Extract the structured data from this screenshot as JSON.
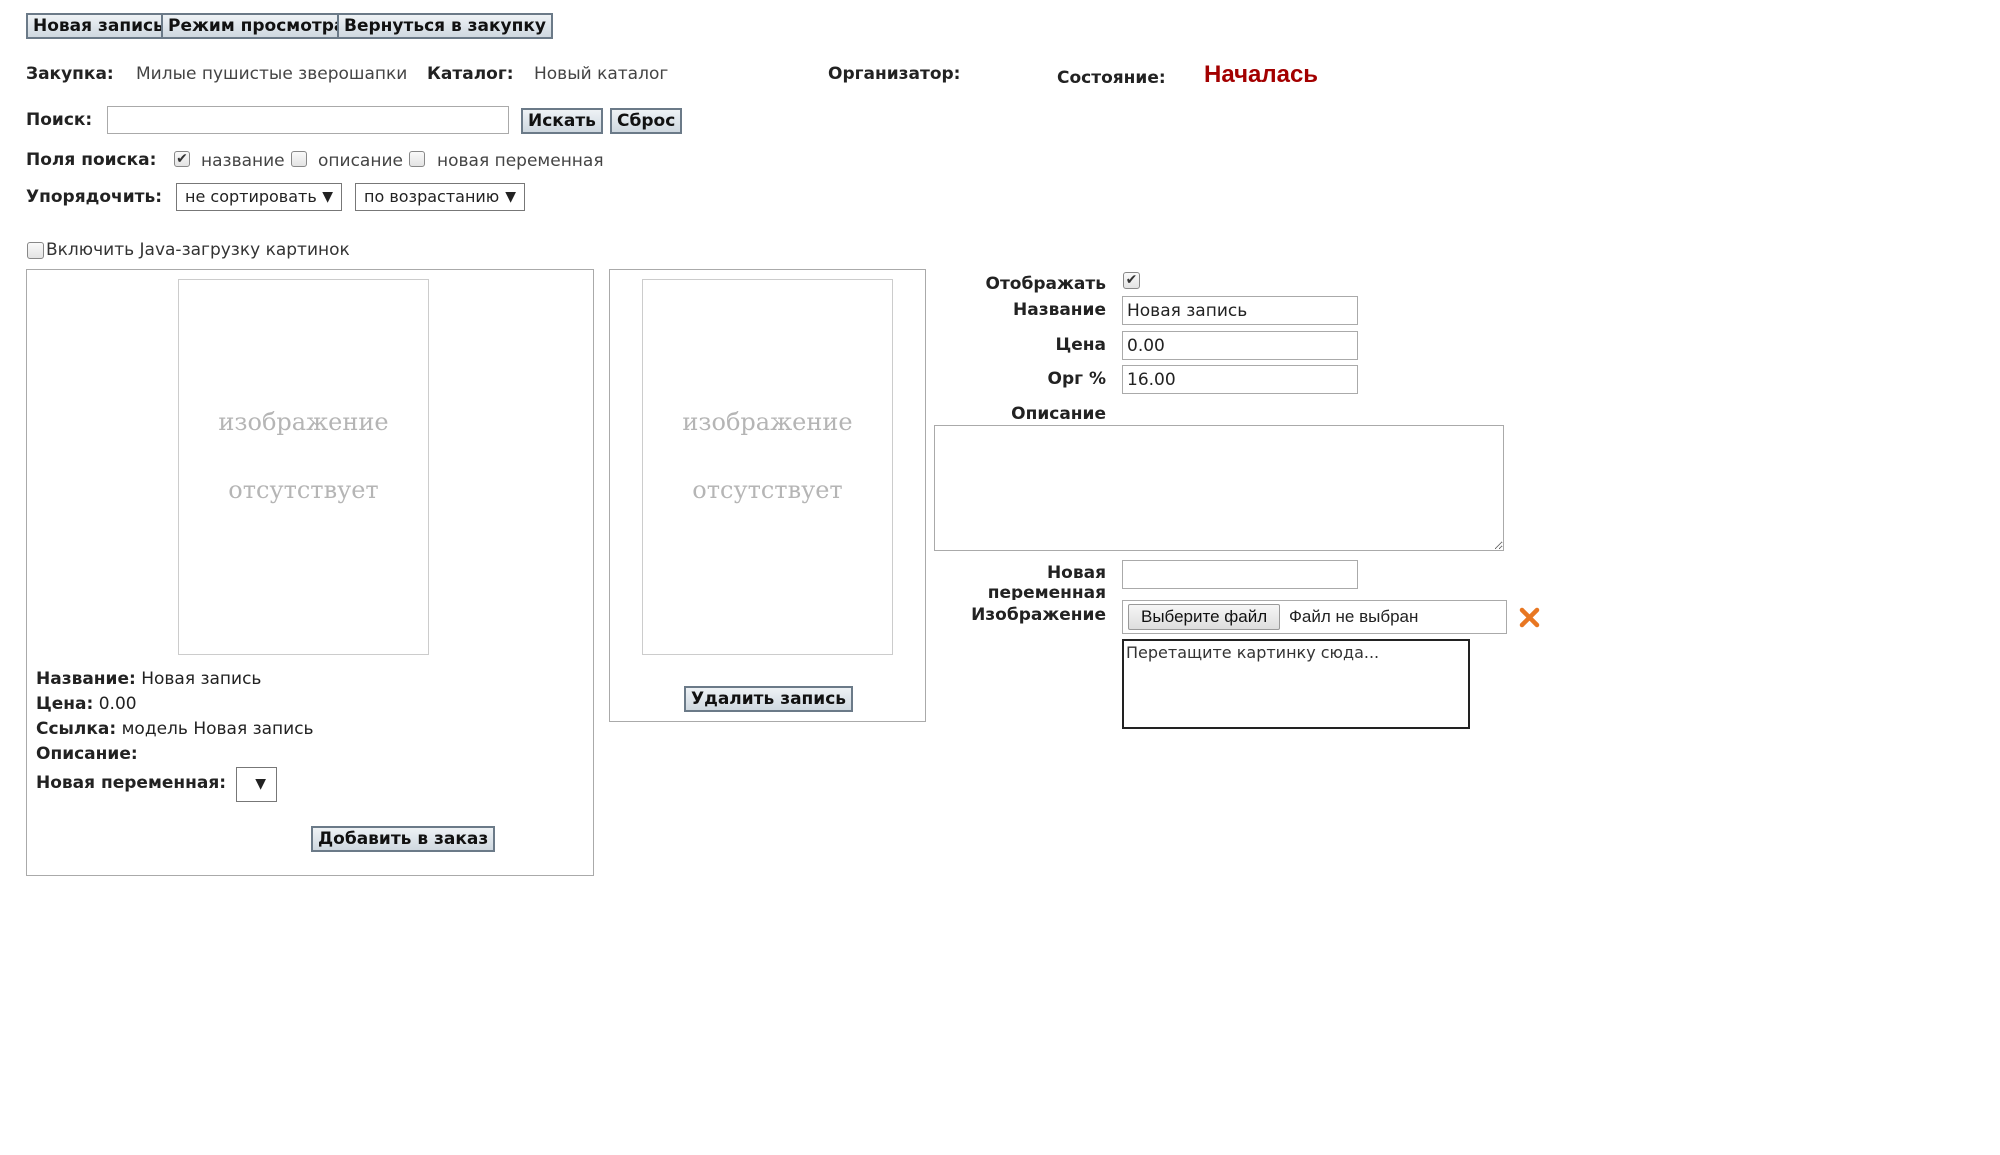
{
  "toolbar": {
    "new_record": "Новая запись",
    "view_mode": "Режим просмотра",
    "back_to_purchase": "Вернуться в закупку"
  },
  "info": {
    "purchase_label": "Закупка:",
    "purchase_value": "Милые пушистые зверошапки",
    "catalog_label": "Каталог:",
    "catalog_value": "Новый каталог",
    "organizer_label": "Организатор:",
    "state_label": "Состояние:",
    "state_value": "Началась",
    "state_color": "#a30000"
  },
  "search": {
    "label": "Поиск:",
    "value": "",
    "search_button": "Искать",
    "reset_button": "Сброс"
  },
  "search_fields": {
    "label": "Поля поиска:",
    "options": [
      {
        "label": "название",
        "checked": true
      },
      {
        "label": "описание",
        "checked": false
      },
      {
        "label": "новая переменная",
        "checked": false
      }
    ]
  },
  "sort": {
    "label": "Упорядочить:",
    "field_selected": "не сортировать",
    "order_selected": "по возрастанию"
  },
  "java_upload": {
    "label": "Включить Java-загрузку картинок",
    "checked": false
  },
  "preview_card": {
    "no_image_line1": "изображение",
    "no_image_line2": "отсутствует",
    "name_label": "Название:",
    "name_value": "Новая запись",
    "price_label": "Цена:",
    "price_value": "0.00",
    "link_label": "Ссылка:",
    "link_value": "модель Новая запись",
    "description_label": "Описание:",
    "new_var_label": "Новая переменная:",
    "add_to_order_button": "Добавить в заказ"
  },
  "edit_card": {
    "no_image_line1": "изображение",
    "no_image_line2": "отсутствует",
    "delete_button": "Удалить запись"
  },
  "form": {
    "display_label": "Отображать",
    "display_checked": true,
    "name_label": "Название",
    "name_value": "Новая запись",
    "price_label": "Цена",
    "price_value": "0.00",
    "org_label": "Орг %",
    "org_value": "16.00",
    "description_label": "Описание",
    "description_value": "",
    "new_var_label_line1": "Новая",
    "new_var_label_line2": "переменная",
    "new_var_value": "",
    "image_label": "Изображение",
    "choose_file_button": "Выберите файл",
    "no_file_text": "Файл не выбран",
    "drop_zone_text": "Перетащите картинку сюда...",
    "remove_icon": "close-x-icon",
    "remove_icon_color": "#e87722"
  }
}
